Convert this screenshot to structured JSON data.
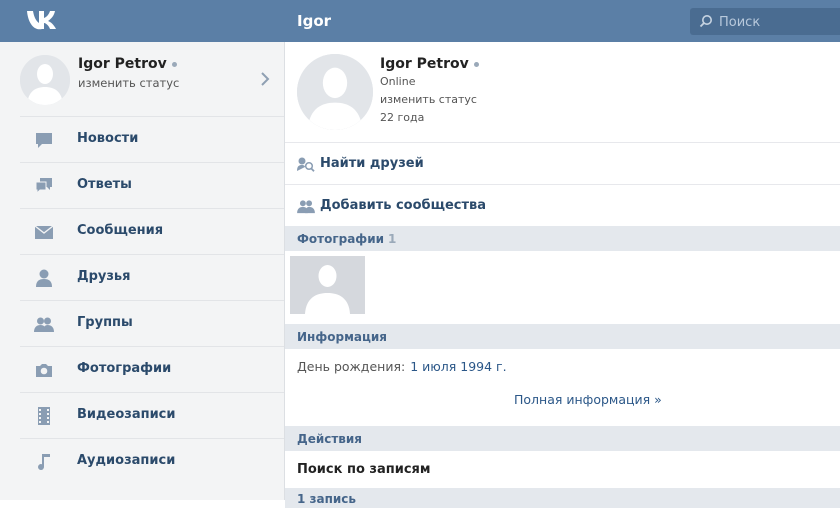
{
  "header": {
    "title": "Igor",
    "search_placeholder": "Поиск"
  },
  "sidebar": {
    "profile": {
      "name": "Igor Petrov",
      "status": "изменить статус"
    },
    "items": [
      {
        "label": "Новости",
        "icon": "news-icon"
      },
      {
        "label": "Ответы",
        "icon": "replies-icon"
      },
      {
        "label": "Сообщения",
        "icon": "messages-icon"
      },
      {
        "label": "Друзья",
        "icon": "friends-icon"
      },
      {
        "label": "Группы",
        "icon": "groups-icon"
      },
      {
        "label": "Фотографии",
        "icon": "photos-icon"
      },
      {
        "label": "Видеозаписи",
        "icon": "videos-icon"
      },
      {
        "label": "Аудиозаписи",
        "icon": "audio-icon"
      }
    ]
  },
  "profile": {
    "name": "Igor Petrov",
    "online": "Online",
    "status": "изменить статус",
    "age": "22 года"
  },
  "actions": {
    "find_friends": "Найти друзей",
    "add_communities": "Добавить сообщества"
  },
  "photos": {
    "title": "Фотографии",
    "count": "1"
  },
  "info": {
    "title": "Информация",
    "birthday_label": "День рождения:",
    "birthday_value": "1 июля 1994 г.",
    "full_info": "Полная информация »"
  },
  "actions_section": {
    "title": "Действия",
    "search_posts": "Поиск по записям"
  },
  "posts": {
    "title": "1 запись"
  },
  "colors": {
    "header_bg": "#5b7fa6",
    "link": "#2b4a6b",
    "section_bg": "#e4e8ed"
  }
}
